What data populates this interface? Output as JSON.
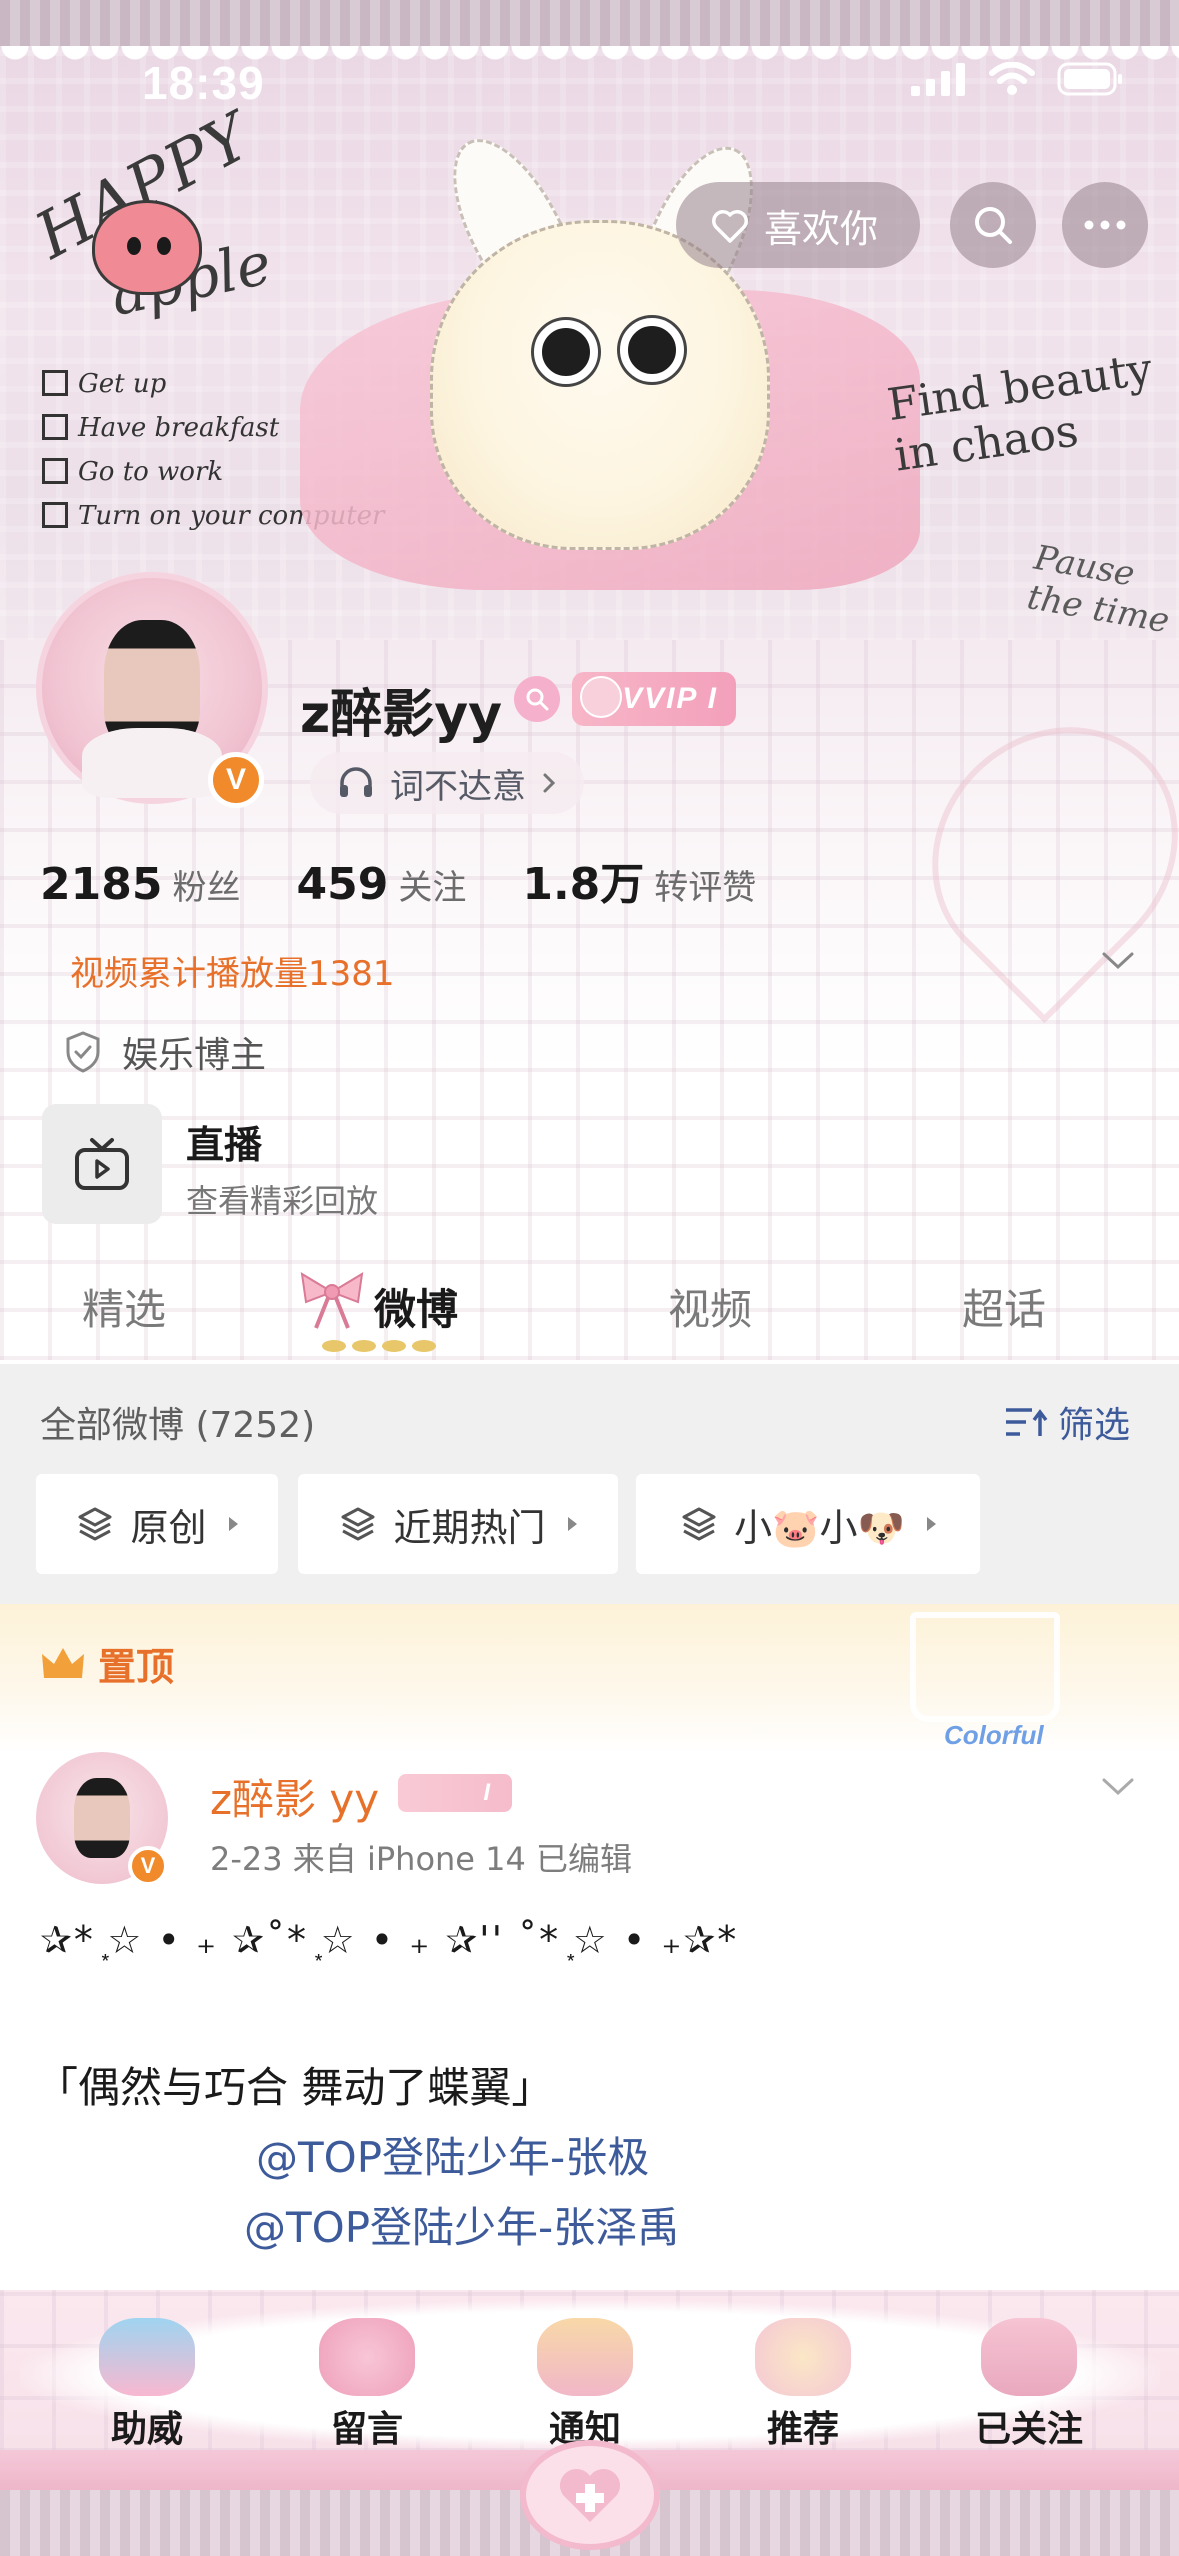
{
  "status_bar": {
    "time": "18:39"
  },
  "header": {
    "like_button": "喜欢你",
    "banner_text": {
      "happy": "HAPPY",
      "apple": "apple",
      "checklist": [
        "Get up",
        "Have breakfast",
        "Go to work",
        "Turn on your computer"
      ],
      "find_beauty": "Find beauty in chaos",
      "pause": "Pause the time"
    }
  },
  "profile": {
    "username": "z醉影yy",
    "vip_badge": "VVIP I",
    "verified_mark": "V",
    "music_status": "词不达意",
    "stats": [
      {
        "value": "2185",
        "label": "粉丝"
      },
      {
        "value": "459",
        "label": "关注"
      },
      {
        "value": "1.8万",
        "label": "转评赞"
      }
    ],
    "play_count": "视频累计播放量1381",
    "tag": "娱乐博主"
  },
  "live": {
    "title": "直播",
    "subtitle": "查看精彩回放"
  },
  "tabs": [
    {
      "label": "精选"
    },
    {
      "label": "微博"
    },
    {
      "label": "视频"
    },
    {
      "label": "超话"
    }
  ],
  "filter": {
    "all_label": "全部微博 (7252)",
    "filter_label": "筛选",
    "chips": [
      "原创",
      "近期热门",
      "小🐷小🐶"
    ]
  },
  "pinned": {
    "label": "置顶",
    "colorful_badge": "Colorful"
  },
  "post": {
    "name": "z醉影 yy",
    "badge": "I",
    "meta": "2-23  来自 iPhone 14  已编辑",
    "line1": "✰* ͙☆ • ₊ ✰˚* ͙☆ • ₊ ✰'' ˚* ͙☆ • ₊✰*",
    "line2": "「偶然与巧合 舞动了蝶翼」",
    "mentions": [
      "@TOP登陆少年-张极",
      "@TOP登陆少年-张泽禹"
    ]
  },
  "bottom_nav": [
    {
      "label": "助威"
    },
    {
      "label": "留言"
    },
    {
      "label": "通知"
    },
    {
      "label": "推荐"
    },
    {
      "label": "已关注"
    }
  ],
  "colors": {
    "accent_orange": "#e7712a",
    "link_blue": "#3d5a9a",
    "pink": "#f3b5c8"
  }
}
